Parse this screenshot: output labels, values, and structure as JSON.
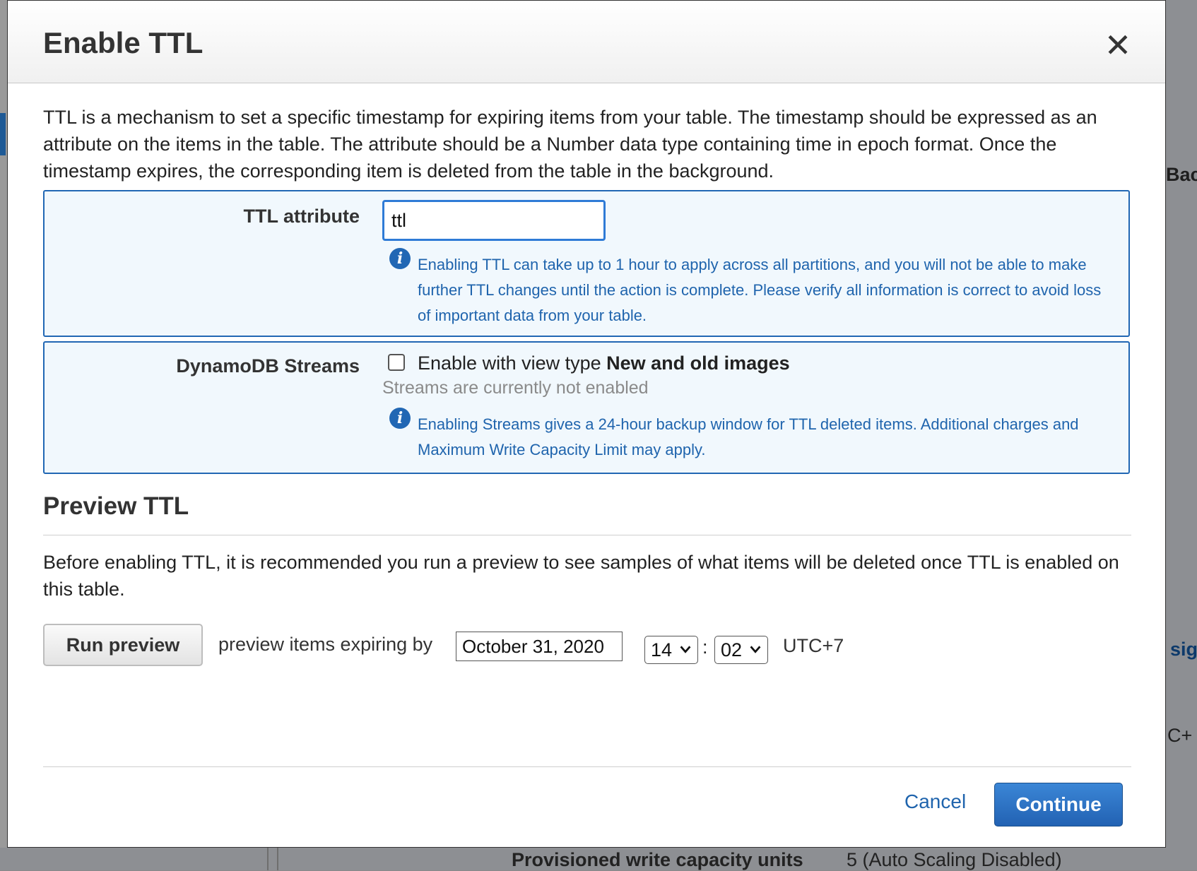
{
  "background": {
    "right_texts": [
      "Bac",
      "sig",
      "C+"
    ],
    "bottom_label": "Provisioned write capacity units",
    "bottom_value": "5 (Auto Scaling Disabled)"
  },
  "modal": {
    "title": "Enable TTL",
    "close_icon": "close-icon",
    "intro": "TTL is a mechanism to set a specific timestamp for expiring items from your table. The timestamp should be expressed as an attribute on the items in the table. The attribute should be a Number data type containing time in epoch format. Once the timestamp expires, the corresponding item is deleted from the table in the background.",
    "ttl_attribute": {
      "label": "TTL attribute",
      "value": "ttl",
      "info": "Enabling TTL can take up to 1 hour to apply across all partitions, and you will not be able to make further TTL changes until the action is complete. Please verify all information is correct to avoid loss of important data from your table."
    },
    "streams": {
      "label": "DynamoDB Streams",
      "checkbox_prefix": "Enable with view type ",
      "checkbox_bold": "New and old images",
      "checked": false,
      "status": "Streams are currently not enabled",
      "info": "Enabling Streams gives a 24-hour backup window for TTL deleted items. Additional charges and Maximum Write Capacity Limit may apply."
    },
    "preview": {
      "title": "Preview TTL",
      "text": "Before enabling TTL, it is recommended you run a preview to see samples of what items will be deleted once TTL is enabled on this table.",
      "run_button": "Run preview",
      "expiring_label": "preview items expiring by",
      "date": "October 31, 2020",
      "hour": "14",
      "minute": "02",
      "separator": ":",
      "timezone": "UTC+7"
    },
    "footer": {
      "cancel": "Cancel",
      "continue": "Continue"
    }
  },
  "colors": {
    "accent": "#2167b4",
    "panel_bg": "#f1f8fd",
    "info_text": "#1f64ad",
    "continue_bg": "#2a6fc2"
  }
}
